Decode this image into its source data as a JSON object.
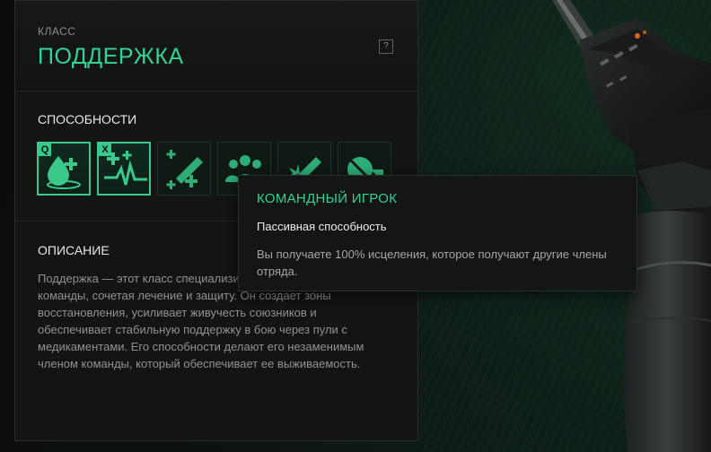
{
  "class_panel": {
    "class_label": "КЛАСС",
    "class_name": "ПОДДЕРЖКА",
    "help_label": "?"
  },
  "abilities": {
    "title": "СПОСОБНОСТИ",
    "items": [
      {
        "key": "Q",
        "icon": "healing-drop-icon",
        "selected": true
      },
      {
        "key": "X",
        "icon": "heartbeat-plus-icon",
        "selected": true
      },
      {
        "key": "",
        "icon": "syringe-plus-icon",
        "selected": false
      },
      {
        "key": "",
        "icon": "team-squad-icon",
        "selected": false
      },
      {
        "key": "",
        "icon": "syringe-burst-icon",
        "selected": false
      },
      {
        "key": "",
        "icon": "pill-shield-icon",
        "selected": false
      }
    ]
  },
  "description": {
    "title": "ОПИСАНИЕ",
    "text": "Поддержка — этот класс специализируется на поддержке команды, сочетая лечение и защиту. Он создает зоны восстановления, усиливает живучесть союзников и обеспечивает стабильную поддержку в бою через пули с медикаментами. Его способности делают его незаменимым членом команды, который обеспечивает ее выживаемость."
  },
  "tooltip": {
    "title": "КОМАНДНЫЙ ИГРОК",
    "type": "Пассивная способность",
    "text": "Вы получаете 100% исцеления, которое получают другие члены отряда."
  },
  "colors": {
    "accent": "#35d394",
    "panel_bg": "#131414",
    "tooltip_bg": "#141515"
  }
}
